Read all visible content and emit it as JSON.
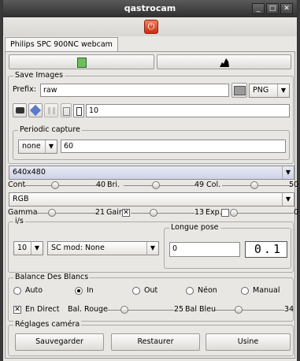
{
  "window": {
    "title": "qastrocam"
  },
  "tab": {
    "label": "Philips SPC 900NC webcam"
  },
  "save_images": {
    "title": "Save Images",
    "prefix_label": "Prefix:",
    "prefix_value": "raw",
    "format": "PNG",
    "frame_count": "10",
    "periodic": {
      "title": "Periodic capture",
      "mode": "none",
      "interval": "60"
    }
  },
  "resolution": "640x480",
  "sliders1": {
    "cont_label": "Cont",
    "cont_value": "40",
    "bri_label": "Bri.",
    "bri_value": "49",
    "col_label": "Col.",
    "col_value": "50"
  },
  "palette": "RGB",
  "sliders2": {
    "gamma_label": "Gamma",
    "gamma_value": "21",
    "gain_label": "Gain",
    "gain_value": "13",
    "exp_label": "Exp.",
    "exp_value": "0"
  },
  "fps": {
    "title": "i/s",
    "rate": "10",
    "sc_mod": "SC mod: None",
    "longue_pose": {
      "title": "Longue pose",
      "value": "0",
      "display": "0.1"
    }
  },
  "white_balance": {
    "title": "Balance Des Blancs",
    "options": [
      "Auto",
      "In",
      "Out",
      "Néon",
      "Manual"
    ],
    "selected": "In",
    "live_label": "En Direct",
    "red_label": "Bal. Rouge",
    "red_value": "25",
    "blue_label": "Bal Bleu",
    "blue_value": "34"
  },
  "camera_settings": {
    "title": "Réglages caméra",
    "save": "Sauvegarder",
    "restore": "Restaurer",
    "factory": "Usine"
  }
}
